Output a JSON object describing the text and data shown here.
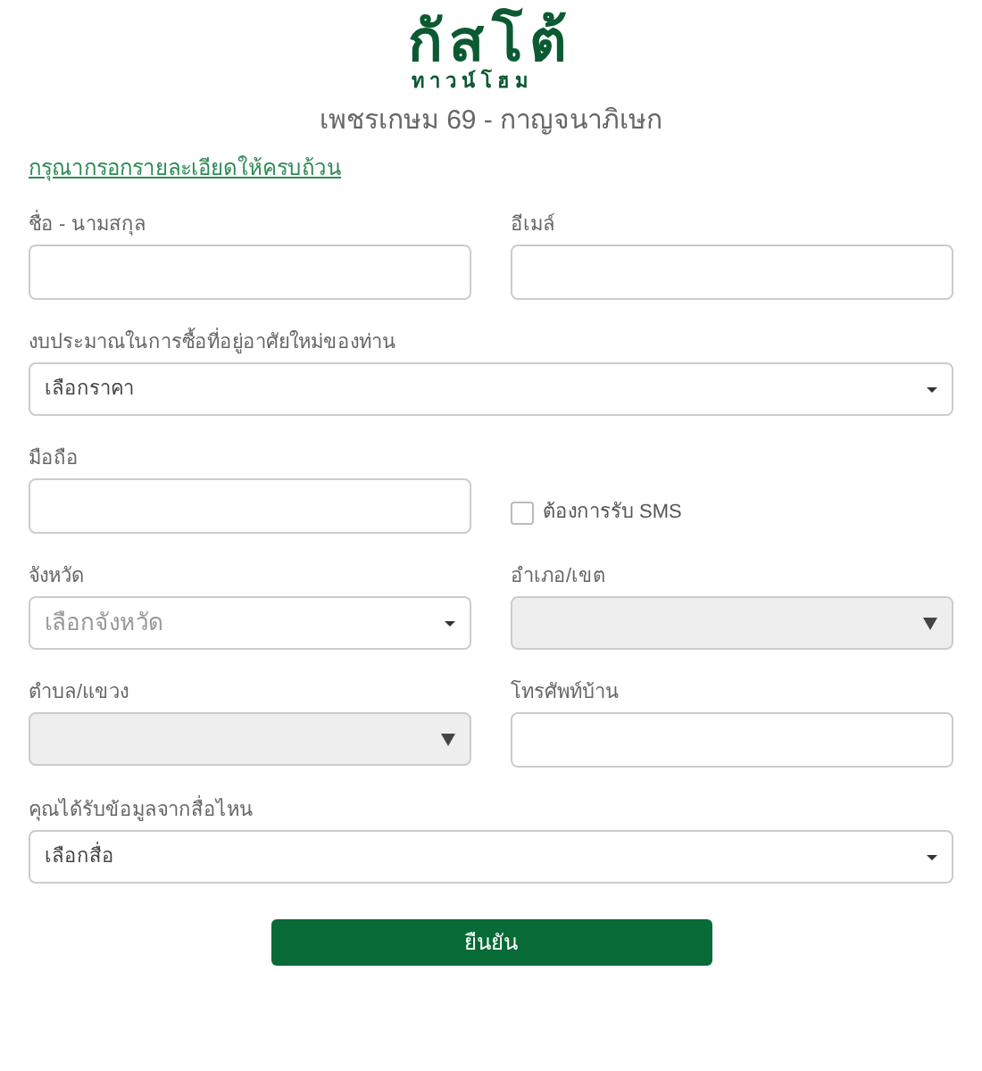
{
  "logo": {
    "name": "กัสโต้",
    "tagline": "ทาวน์โฮม"
  },
  "project_title": "เพชรเกษม 69 - กาญจนาภิเษก",
  "notice_link": "กรุณากรอกรายละเอียดให้ครบถ้วน",
  "form_rows": [
    [
      {
        "kind": "text",
        "label": "ชื่อ - นามสกุล"
      },
      {
        "kind": "text",
        "label": "อีเมล์"
      }
    ],
    [
      {
        "kind": "select",
        "label": "งบประมาณในการซื้อที่อยู่อาศัยใหม่ของท่าน",
        "value": "เลือกราคา",
        "disabled": false
      }
    ],
    [
      {
        "kind": "text",
        "label": "มือถือ"
      },
      {
        "kind": "checkbox",
        "label": "ต้องการรับ SMS",
        "checked": false
      }
    ],
    [
      {
        "kind": "select",
        "label": "จังหวัด",
        "placeholder": "เลือกจังหวัด",
        "disabled": false
      },
      {
        "kind": "select",
        "label": "อำเภอ/เขต",
        "disabled": true
      }
    ],
    [
      {
        "kind": "select",
        "label": "ตำบล/แขวง",
        "disabled": true
      },
      {
        "kind": "text",
        "label": "โทรศัพท์บ้าน"
      }
    ],
    [
      {
        "kind": "select",
        "label": "คุณได้รับข้อมูลจากสื่อไหน",
        "value": "เลือกสื่อ",
        "disabled": false
      }
    ]
  ],
  "submit_button": "ยืนยัน"
}
